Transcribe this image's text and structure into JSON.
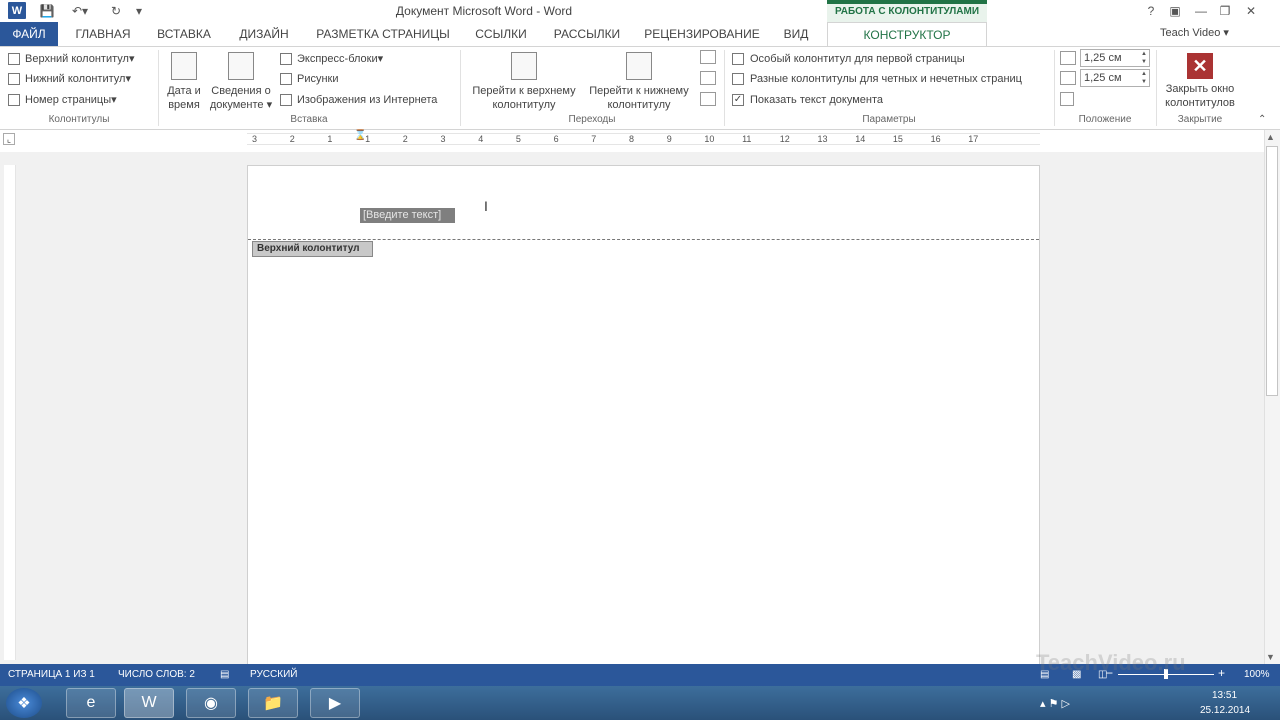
{
  "window": {
    "title": "Документ Microsoft Word - Word",
    "context_group": "РАБОТА С КОЛОНТИТУЛАМИ",
    "help": "?",
    "user": "Teach Video"
  },
  "tabs": [
    "ФАЙЛ",
    "ГЛАВНАЯ",
    "ВСТАВКА",
    "ДИЗАЙН",
    "РАЗМЕТКА СТРАНИЦЫ",
    "ССЫЛКИ",
    "РАССЫЛКИ",
    "РЕЦЕНЗИРОВАНИЕ",
    "ВИД",
    "КОНСТРУКТОР"
  ],
  "ribbon": {
    "kolontituly": {
      "label": "Колонтитулы",
      "items": [
        "Верхний колонтитул",
        "Нижний колонтитул",
        "Номер страницы"
      ]
    },
    "vstavka": {
      "label": "Вставка",
      "date_line1": "Дата и",
      "date_line2": "время",
      "info_line1": "Сведения о",
      "info_line2": "документе",
      "items": [
        "Экспресс-блоки",
        "Рисунки",
        "Изображения из Интернета"
      ]
    },
    "perehody": {
      "label": "Переходы",
      "to_header_line1": "Перейти к верхнему",
      "to_header_line2": "колонтитулу",
      "to_footer_line1": "Перейти к нижнему",
      "to_footer_line2": "колонтитулу"
    },
    "parametry": {
      "label": "Параметры",
      "options": [
        {
          "label": "Особый колонтитул для первой страницы",
          "checked": false
        },
        {
          "label": "Разные колонтитулы для четных и нечетных страниц",
          "checked": false
        },
        {
          "label": "Показать текст документа",
          "checked": true
        }
      ]
    },
    "polozhenie": {
      "label": "Положение",
      "header_pos": "1,25 см",
      "footer_pos": "1,25 см"
    },
    "zakrytie": {
      "label": "Закрытие",
      "close_line1": "Закрыть окно",
      "close_line2": "колонтитулов"
    }
  },
  "ruler": [
    "3",
    "2",
    "1",
    "1",
    "2",
    "3",
    "4",
    "5",
    "6",
    "7",
    "8",
    "9",
    "10",
    "11",
    "12",
    "13",
    "14",
    "15",
    "16",
    "17"
  ],
  "document": {
    "placeholder": "[Введите текст]",
    "header_tag": "Верхний колонтитул"
  },
  "status": {
    "page": "СТРАНИЦА 1 ИЗ 1",
    "words": "ЧИСЛО СЛОВ: 2",
    "lang": "РУССКИЙ",
    "zoom": "100%"
  },
  "tray": {
    "time": "13:51",
    "date": "25.12.2014"
  },
  "watermark": "TeachVideo.ru"
}
